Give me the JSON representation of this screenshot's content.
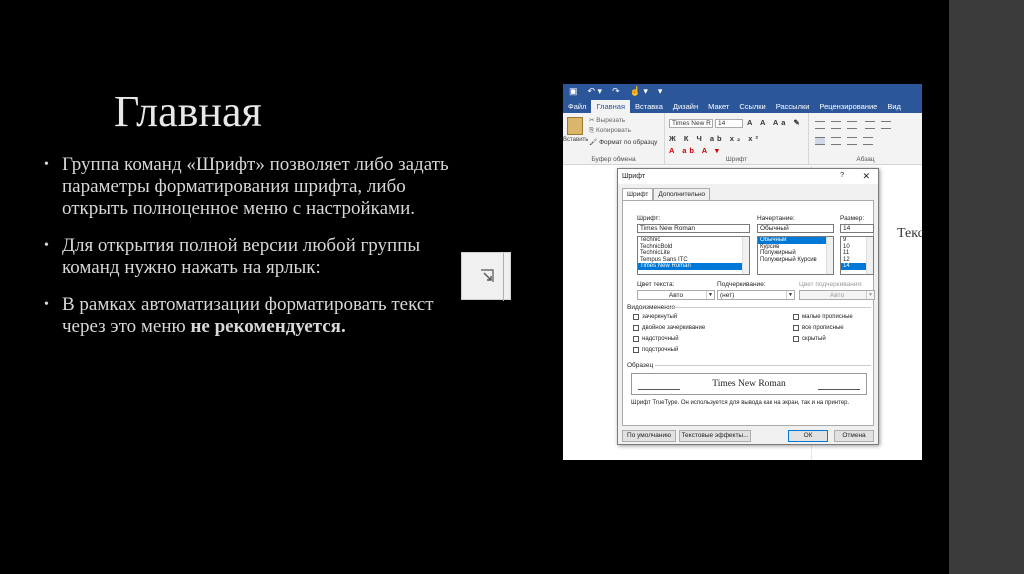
{
  "slide": {
    "title": "Главная",
    "bullets": [
      {
        "text": "Группа команд «Шрифт» позволяет либо задать параметры форматирования шрифта, либо открыть полноценное меню с настройками."
      },
      {
        "text": "Для открытия полной версии любой группы команд нужно нажать на ярлык:"
      },
      {
        "text": "В рамках автоматизации форматировать текст через это меню ",
        "bold": "не рекомендуется."
      }
    ]
  },
  "word": {
    "tabs": [
      "Файл",
      "Главная",
      "Вставка",
      "Дизайн",
      "Макет",
      "Ссылки",
      "Рассылки",
      "Рецензирование",
      "Вид"
    ],
    "active_tab": "Главная",
    "clipboard": {
      "paste": "Вставить",
      "cut": "Вырезать",
      "copy": "Копировать",
      "format_painter": "Формат по образцу",
      "label": "Буфер обмена"
    },
    "font_group": {
      "font_name": "Times New R",
      "font_size": "14",
      "label": "Шрифт"
    },
    "paragraph_label": "Абзац",
    "doc_text": "Текс"
  },
  "dialog": {
    "title": "Шрифт",
    "help": "?",
    "close": "✕",
    "tabs": [
      "Шрифт",
      "Дополнительно"
    ],
    "font_label": "Шрифт:",
    "font_value": "Times New Roman",
    "font_list": [
      "Technic",
      "TechnicBold",
      "TechnicLite",
      "Tempus Sans ITC",
      "Times New Roman"
    ],
    "style_label": "Начертание:",
    "style_value": "Обычный",
    "style_list": [
      "Обычный",
      "Курсив",
      "Полужирный",
      "Полужирный Курсив"
    ],
    "size_label": "Размер:",
    "size_value": "14",
    "size_list": [
      "9",
      "10",
      "11",
      "12",
      "14"
    ],
    "color_label": "Цвет текста:",
    "color_value": "Авто",
    "underline_label": "Подчеркивание:",
    "underline_value": "(нет)",
    "underline_color_label": "Цвет подчеркивания:",
    "underline_color_value": "Авто",
    "effects_label": "Видоизменение",
    "effects_left": [
      "зачеркнутый",
      "двойное зачеркивание",
      "надстрочный",
      "подстрочный"
    ],
    "effects_right": [
      "малые прописные",
      "все прописные",
      "скрытый"
    ],
    "sample_label": "Образец",
    "sample_text": "Times New Roman",
    "note": "Шрифт TrueType. Он используется для вывода как на экран, так и на принтер.",
    "btn_default": "По умолчанию",
    "btn_effects": "Текстовые эффекты...",
    "btn_ok": "ОК",
    "btn_cancel": "Отмена"
  }
}
